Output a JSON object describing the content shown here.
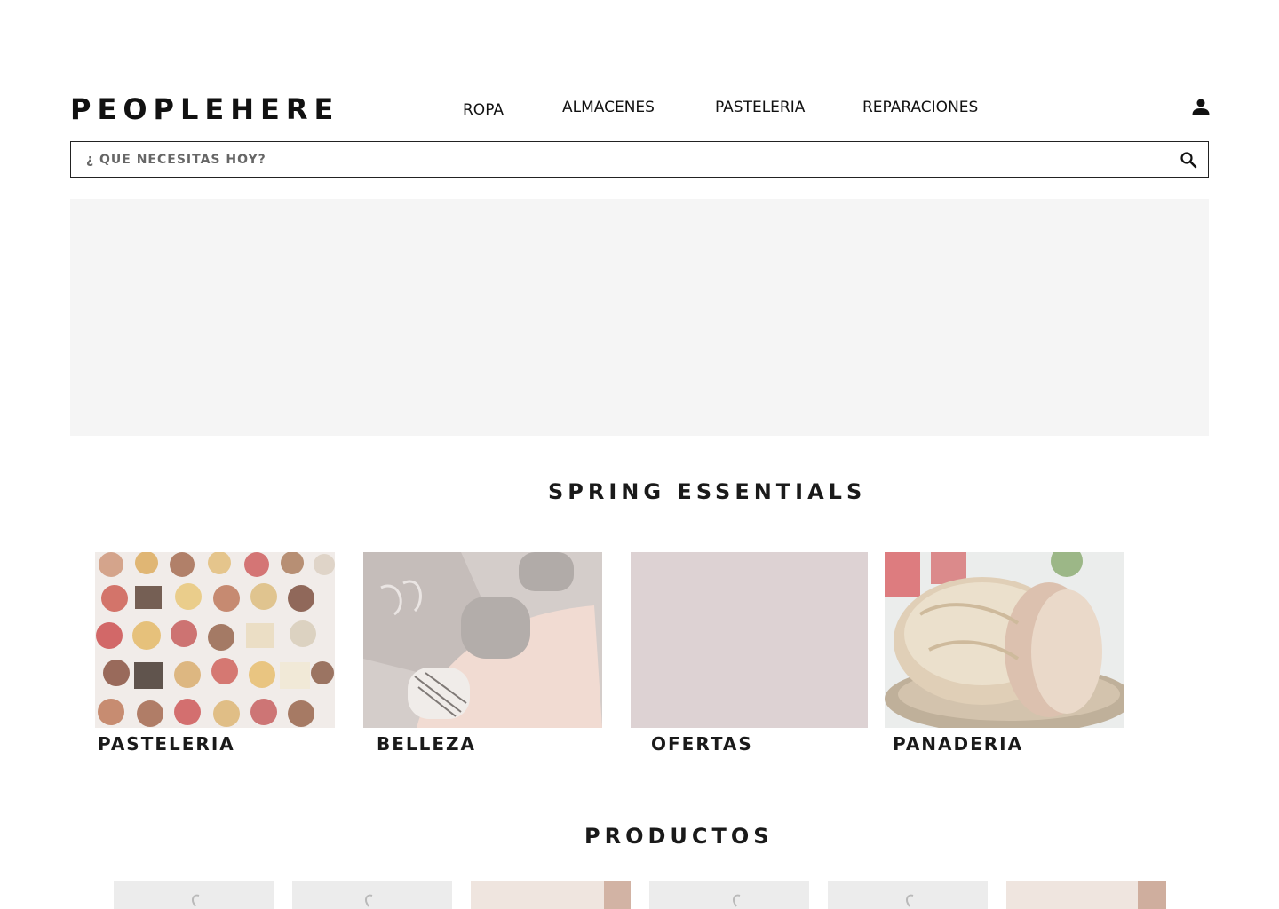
{
  "brand": {
    "name": "PEOPLEHERE"
  },
  "nav": {
    "items": [
      {
        "label": "ROPA"
      },
      {
        "label": "ALMACENES"
      },
      {
        "label": "PASTELERIA"
      },
      {
        "label": "REPARACIONES"
      }
    ],
    "user_icon": "user-icon"
  },
  "search": {
    "placeholder": "¿ QUE NECESITAS HOY?",
    "value": "",
    "icon": "search-icon"
  },
  "sections": {
    "spring": {
      "title": "SPRING ESSENTIALS"
    },
    "products": {
      "title": "PRODUCTOS"
    }
  },
  "categories": [
    {
      "label": "PASTELERIA",
      "image": "pastries"
    },
    {
      "label": "BELLEZA",
      "image": "nail-polish"
    },
    {
      "label": "OFERTAS",
      "image": "plain-pink"
    },
    {
      "label": "PANADERIA",
      "image": "bread"
    }
  ],
  "colors": {
    "hero_bg": "#f5f5f5",
    "ofertas_bg": "#ddd2d3",
    "text": "#111111"
  }
}
